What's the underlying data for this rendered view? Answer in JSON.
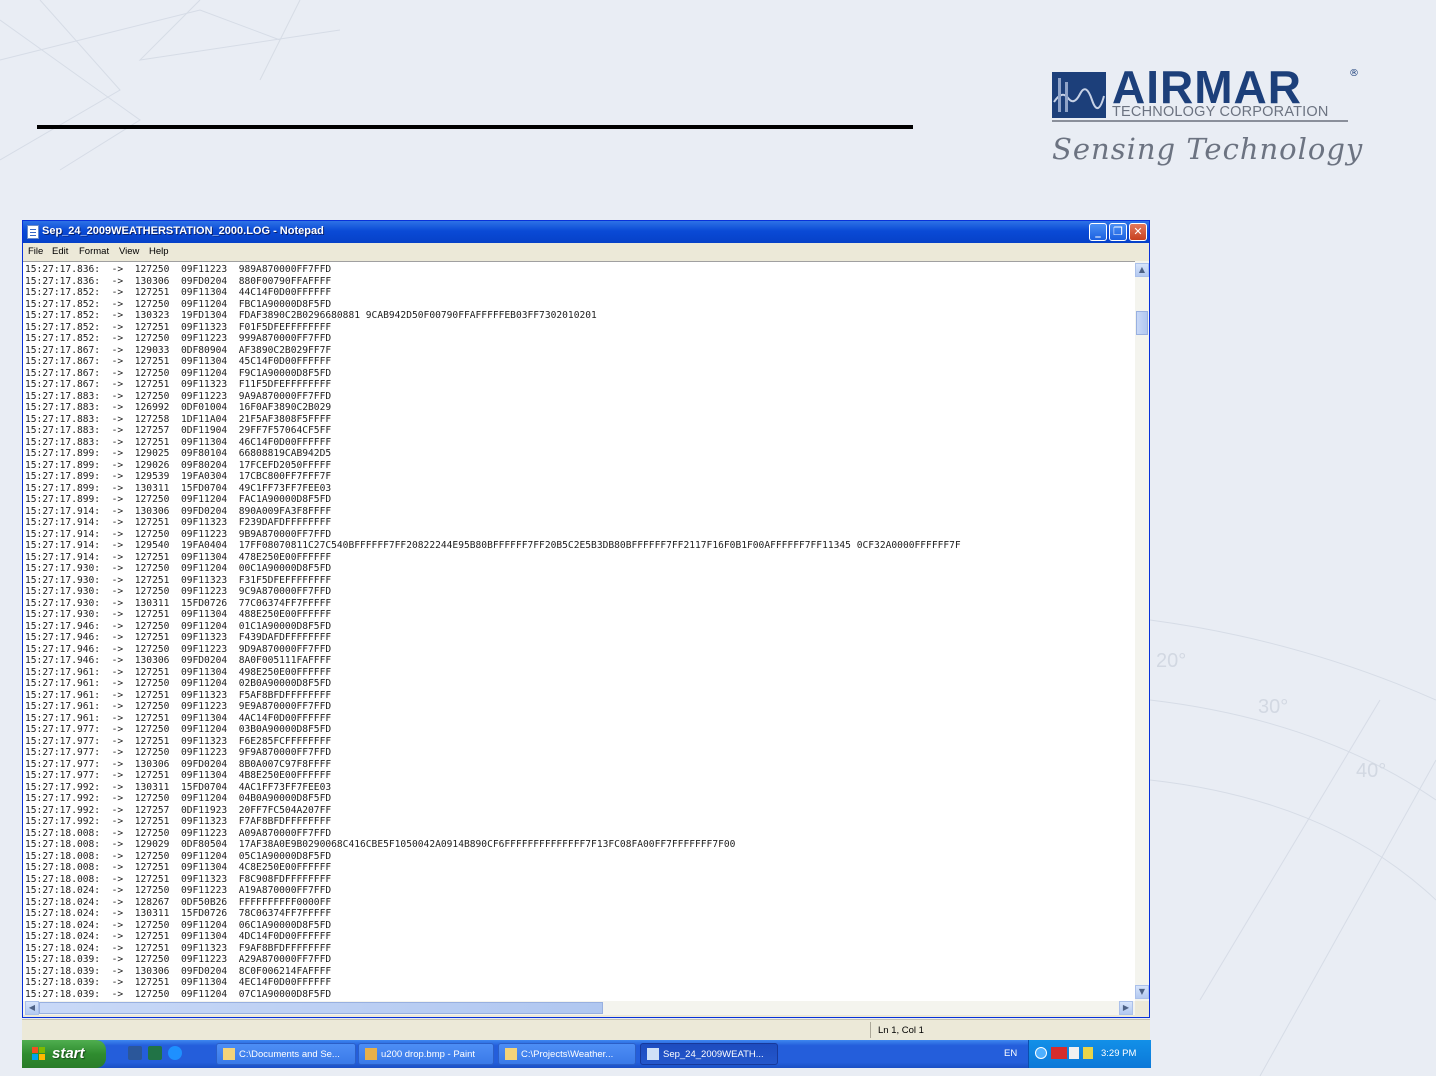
{
  "logo": {
    "name": "AIRMAR",
    "registered": "®",
    "subtitle": "TECHNOLOGY CORPORATION",
    "tagline": "Sensing Technology"
  },
  "compass_marks": [
    "20°",
    "30°",
    "40°"
  ],
  "window": {
    "title": "Sep_24_2009WEATHERSTATION_2000.LOG - Notepad",
    "controls": [
      "minimize",
      "maximize",
      "close"
    ],
    "menu": [
      "File",
      "Edit",
      "Format",
      "View",
      "Help"
    ],
    "status_position": "Ln 1, Col 1"
  },
  "log_lines": [
    "15:27:17.836:  ->  127250  09F11223  989A870000FF7FFD",
    "15:27:17.836:  ->  130306  09FD0204  880F00790FFAFFFF",
    "15:27:17.852:  ->  127251  09F11304  44C14F0D00FFFFFF",
    "15:27:17.852:  ->  127250  09F11204  FBC1A90000D8F5FD",
    "15:27:17.852:  ->  130323  19FD1304  FDAF3890C2B0296680881 9CAB942D50F00790FFAFFFFFEB03FF7302010201",
    "15:27:17.852:  ->  127251  09F11323  F01F5DFEFFFFFFFF",
    "15:27:17.852:  ->  127250  09F11223  999A870000FF7FFD",
    "15:27:17.867:  ->  129033  0DF80904  AF3890C2B029FF7F",
    "15:27:17.867:  ->  127251  09F11304  45C14F0D00FFFFFF",
    "15:27:17.867:  ->  127250  09F11204  F9C1A90000D8F5FD",
    "15:27:17.867:  ->  127251  09F11323  F11F5DFEFFFFFFFF",
    "15:27:17.883:  ->  127250  09F11223  9A9A870000FF7FFD",
    "15:27:17.883:  ->  126992  0DF01004  16F0AF3890C2B029",
    "15:27:17.883:  ->  127258  1DF11A04  21F5AF3808F5FFFF",
    "15:27:17.883:  ->  127257  0DF11904  29FF7F57064CF5FF",
    "15:27:17.883:  ->  127251  09F11304  46C14F0D00FFFFFF",
    "15:27:17.899:  ->  129025  09F80104  66808819CAB942D5",
    "15:27:17.899:  ->  129026  09F80204  17FCEFD2050FFFFF",
    "15:27:17.899:  ->  129539  19FA0304  17CBC800FF7FFF7F",
    "15:27:17.899:  ->  130311  15FD0704  49C1FF73FF7FEE03",
    "15:27:17.899:  ->  127250  09F11204  FAC1A90000D8F5FD",
    "15:27:17.914:  ->  130306  09FD0204  890A009FA3F8FFFF",
    "15:27:17.914:  ->  127251  09F11323  F239DAFDFFFFFFFF",
    "15:27:17.914:  ->  127250  09F11223  9B9A870000FF7FFD",
    "15:27:17.914:  ->  129540  19FA0404  17FF08070811C27C540BFFFFFF7FF20822244E95B80BFFFFFF7FF20B5C2E5B3DB80BFFFFFF7FF2117F16F0B1F00AFFFFFF7FF11345 0CF32A0000FFFFFF7F",
    "15:27:17.914:  ->  127251  09F11304  478E250E00FFFFFF",
    "15:27:17.930:  ->  127250  09F11204  00C1A90000D8F5FD",
    "15:27:17.930:  ->  127251  09F11323  F31F5DFEFFFFFFFF",
    "15:27:17.930:  ->  127250  09F11223  9C9A870000FF7FFD",
    "15:27:17.930:  ->  130311  15FD0726  77C06374FF7FFFFF",
    "15:27:17.930:  ->  127251  09F11304  488E250E00FFFFFF",
    "15:27:17.946:  ->  127250  09F11204  01C1A90000D8F5FD",
    "15:27:17.946:  ->  127251  09F11323  F439DAFDFFFFFFFF",
    "15:27:17.946:  ->  127250  09F11223  9D9A870000FF7FFD",
    "15:27:17.946:  ->  130306  09FD0204  8A0F005111FAFFFF",
    "15:27:17.961:  ->  127251  09F11304  498E250E00FFFFFF",
    "15:27:17.961:  ->  127250  09F11204  02B0A90000D8F5FD",
    "15:27:17.961:  ->  127251  09F11323  F5AF8BFDFFFFFFFF",
    "15:27:17.961:  ->  127250  09F11223  9E9A870000FF7FFD",
    "15:27:17.961:  ->  127251  09F11304  4AC14F0D00FFFFFF",
    "15:27:17.977:  ->  127250  09F11204  03B0A90000D8F5FD",
    "15:27:17.977:  ->  127251  09F11323  F6E285FCFFFFFFFF",
    "15:27:17.977:  ->  127250  09F11223  9F9A870000FF7FFD",
    "15:27:17.977:  ->  130306  09FD0204  8B0A007C97F8FFFF",
    "15:27:17.977:  ->  127251  09F11304  4B8E250E00FFFFFF",
    "15:27:17.992:  ->  130311  15FD0704  4AC1FF73FF7FEE03",
    "15:27:17.992:  ->  127250  09F11204  04B0A90000D8F5FD",
    "15:27:17.992:  ->  127257  0DF11923  20FF7FC504A207FF",
    "15:27:17.992:  ->  127251  09F11323  F7AF8BFDFFFFFFFF",
    "15:27:18.008:  ->  127250  09F11223  A09A870000FF7FFD",
    "15:27:18.008:  ->  129029  0DF80504  17AF38A0E9B0290068C416CBE5F1050042A0914B890CF6FFFFFFFFFFFFFF7F13FC08FA00FF7FFFFFFF7F00",
    "15:27:18.008:  ->  127250  09F11204  05C1A90000D8F5FD",
    "15:27:18.008:  ->  127251  09F11304  4C8E250E00FFFFFF",
    "15:27:18.008:  ->  127251  09F11323  F8C908FDFFFFFFFF",
    "15:27:18.024:  ->  127250  09F11223  A19A870000FF7FFD",
    "15:27:18.024:  ->  128267  0DF50B26  FFFFFFFFFF0000FF",
    "15:27:18.024:  ->  130311  15FD0726  78C06374FF7FFFFF",
    "15:27:18.024:  ->  127250  09F11204  06C1A90000D8F5FD",
    "15:27:18.024:  ->  127251  09F11304  4DC14F0D00FFFFFF",
    "15:27:18.024:  ->  127251  09F11323  F9AF8BFDFFFFFFFF",
    "15:27:18.039:  ->  127250  09F11223  A29A870000FF7FFD",
    "15:27:18.039:  ->  130306  09FD0204  8C0F006214FAFFFF",
    "15:27:18.039:  ->  127251  09F11304  4EC14F0D00FFFFFF",
    "15:27:18.039:  ->  127250  09F11204  07C1A90000D8F5FD"
  ],
  "taskbar": {
    "start_label": "start",
    "tasks": [
      {
        "label": "C:\\Documents and Se...",
        "icon": "folder-icon"
      },
      {
        "label": "u200 drop.bmp - Paint",
        "icon": "paint-icon"
      },
      {
        "label": "C:\\Projects\\Weather...",
        "icon": "folder-icon"
      },
      {
        "label": "Sep_24_2009WEATH...",
        "icon": "notepad-icon"
      }
    ],
    "language": "EN",
    "clock": "3:29 PM"
  },
  "colors": {
    "brand": "#1c3f7a",
    "titlebar": "#0a4ad6",
    "taskbar": "#245edb",
    "start": "#2f8c2f"
  }
}
